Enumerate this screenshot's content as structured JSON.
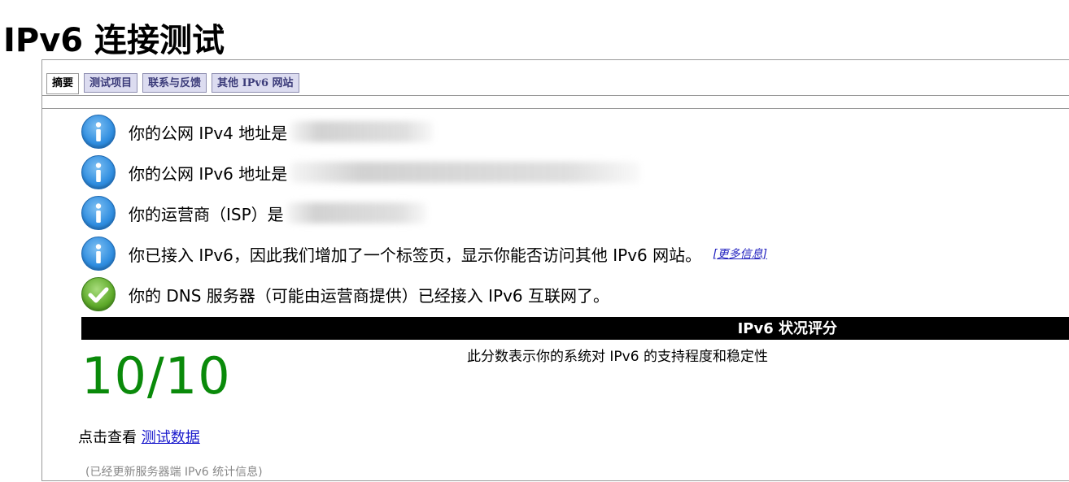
{
  "page": {
    "title": "IPv6 连接测试"
  },
  "tabs": [
    {
      "label": "摘要",
      "active": true
    },
    {
      "label": "测试项目",
      "active": false
    },
    {
      "label": "联系与反馈",
      "active": false
    },
    {
      "label": "其他 IPv6 网站",
      "active": false
    }
  ],
  "info": [
    {
      "icon": "info-icon",
      "text": "你的公网 IPv4 地址是",
      "value": ""
    },
    {
      "icon": "info-icon",
      "text": "你的公网 IPv6 地址是",
      "value": ""
    },
    {
      "icon": "info-icon",
      "text": "你的运营商（ISP）是",
      "value": ""
    },
    {
      "icon": "info-icon",
      "text": "你已接入 IPv6，因此我们增加了一个标签页，显示你能否访问其他 IPv6 网站。",
      "link": "[更多信息]"
    },
    {
      "icon": "check-icon",
      "text": "你的 DNS 服务器（可能由运营商提供）已经接入 IPv6 互联网了。"
    }
  ],
  "score": {
    "header": "IPv6 状况评分",
    "value": "10/10",
    "description": "此分数表示你的系统对 IPv6 的支持程度和稳定性",
    "color": "#0a8a0a"
  },
  "footer": {
    "view_prefix": "点击查看",
    "view_link": "测试数据",
    "stats_note": "(已经更新服务器端 IPv6 统计信息)"
  }
}
